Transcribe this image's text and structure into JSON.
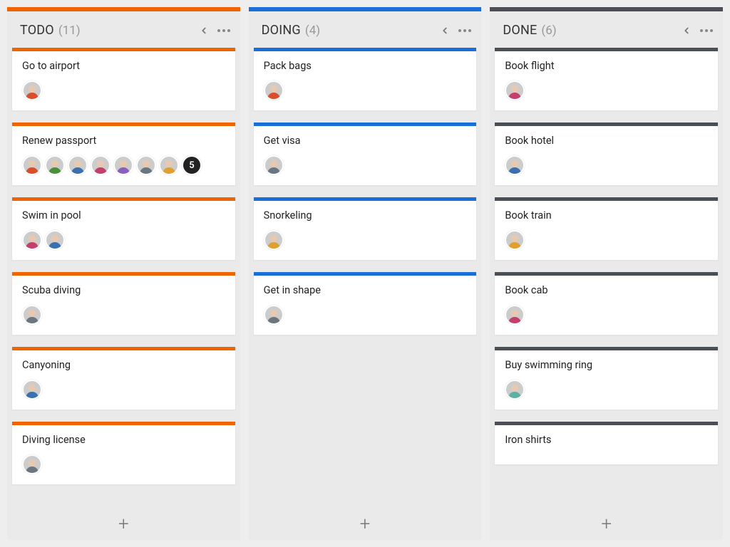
{
  "colors": {
    "todo": "#f06400",
    "doing": "#1a6ed8",
    "done": "#4a4f55"
  },
  "avatar_palette": {
    "a": "#d94f2b",
    "b": "#4a8f3c",
    "c": "#3a6fb0",
    "d": "#c43f6b",
    "e": "#8a5fc0",
    "f": "#6b7680",
    "g": "#e0a030",
    "h": "#5fb0a0",
    "plus": "#222222"
  },
  "columns": [
    {
      "id": "todo",
      "title": "TODO",
      "count": "(11)",
      "accent": "#f06400",
      "cards": [
        {
          "title": "Go to airport",
          "avatars": [
            "a"
          ]
        },
        {
          "title": "Renew passport",
          "avatars": [
            "a",
            "b",
            "c",
            "d",
            "e",
            "f",
            "g"
          ],
          "overflow": "5"
        },
        {
          "title": "Swim in pool",
          "avatars": [
            "d",
            "c"
          ]
        },
        {
          "title": "Scuba diving",
          "avatars": [
            "f"
          ]
        },
        {
          "title": "Canyoning",
          "avatars": [
            "c"
          ]
        },
        {
          "title": "Diving license",
          "avatars": [
            "f"
          ]
        }
      ]
    },
    {
      "id": "doing",
      "title": "DOING",
      "count": "(4)",
      "accent": "#1a6ed8",
      "cards": [
        {
          "title": "Pack bags",
          "avatars": [
            "a"
          ]
        },
        {
          "title": "Get visa",
          "avatars": [
            "f"
          ]
        },
        {
          "title": "Snorkeling",
          "avatars": [
            "g"
          ]
        },
        {
          "title": "Get in shape",
          "avatars": [
            "f"
          ]
        }
      ]
    },
    {
      "id": "done",
      "title": "DONE",
      "count": "(6)",
      "accent": "#4a4f55",
      "cards": [
        {
          "title": "Book flight",
          "avatars": [
            "d"
          ]
        },
        {
          "title": "Book hotel",
          "avatars": [
            "c"
          ]
        },
        {
          "title": "Book train",
          "avatars": [
            "g"
          ]
        },
        {
          "title": "Book cab",
          "avatars": [
            "d"
          ]
        },
        {
          "title": "Buy swimming ring",
          "avatars": [
            "h"
          ]
        },
        {
          "title": "Iron shirts",
          "avatars": []
        }
      ]
    }
  ],
  "icons": {
    "add": "+"
  }
}
